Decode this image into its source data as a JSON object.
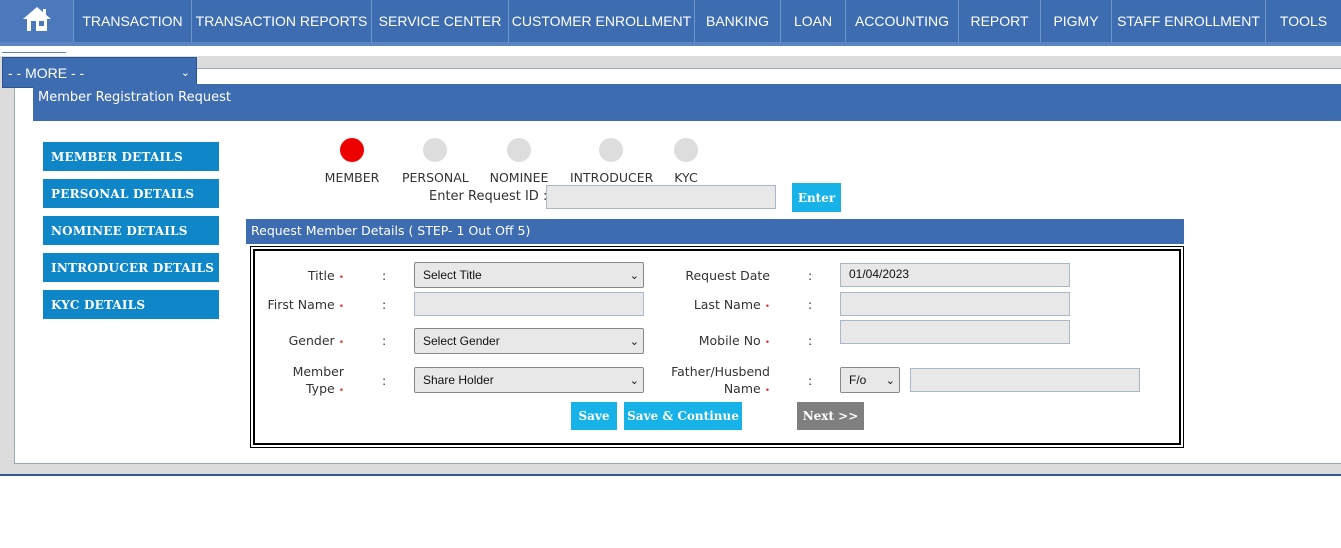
{
  "nav": {
    "items": [
      {
        "label": "TRANSACTION"
      },
      {
        "label": "TRANSACTION REPORTS"
      },
      {
        "label": "SERVICE CENTER"
      },
      {
        "label": "CUSTOMER ENROLLMENT"
      },
      {
        "label": "BANKING"
      },
      {
        "label": "LOAN"
      },
      {
        "label": "ACCOUNTING"
      },
      {
        "label": "REPORT"
      },
      {
        "label": "PIGMY"
      },
      {
        "label": "STAFF ENROLLMENT"
      },
      {
        "label": "TOOLS"
      }
    ],
    "home_icon": "home-icon"
  },
  "more_select": {
    "value": "- - MORE - -"
  },
  "page_title": "Member Registration Request",
  "sidebar": {
    "items": [
      {
        "label": "MEMBER DETAILS"
      },
      {
        "label": "PERSONAL DETAILS"
      },
      {
        "label": "NOMINEE DETAILS"
      },
      {
        "label": "INTRODUCER DETAILS"
      },
      {
        "label": "KYC DETAILS"
      }
    ]
  },
  "steps": [
    {
      "label": "MEMBER",
      "active": true
    },
    {
      "label": "PERSONAL",
      "active": false
    },
    {
      "label": "NOMINEE",
      "active": false
    },
    {
      "label": "INTRODUCER",
      "active": false
    },
    {
      "label": "KYC",
      "active": false
    }
  ],
  "request": {
    "label": "Enter Request ID :",
    "value": "",
    "enter_label": "Enter"
  },
  "section_title": "Request Member Details ( STEP- 1 Out Off 5)",
  "form": {
    "colon": ":",
    "required_mark": "•",
    "title": {
      "label": "Title",
      "value": "Select Title"
    },
    "request_date": {
      "label": "Request Date",
      "value": "01/04/2023"
    },
    "first_name": {
      "label": "First Name",
      "value": ""
    },
    "last_name": {
      "label": "Last Name",
      "value": ""
    },
    "gender": {
      "label": "Gender",
      "value": "Select Gender"
    },
    "mobile_no": {
      "label": "Mobile No",
      "value": ""
    },
    "member_type": {
      "label_line1": "Member",
      "label_line2": "Type",
      "value": "Share Holder"
    },
    "father_husband": {
      "label_line1": "Father/Husbend",
      "label_line2": "Name",
      "relation_value": "F/o",
      "value": ""
    }
  },
  "buttons": {
    "save": "Save",
    "save_continue": "Save & Continue",
    "next": "Next >>"
  },
  "colors": {
    "nav": "#3d6db0",
    "sidebar": "#0e86c8",
    "button": "#16b2e8",
    "active_step": "#ee0000"
  }
}
